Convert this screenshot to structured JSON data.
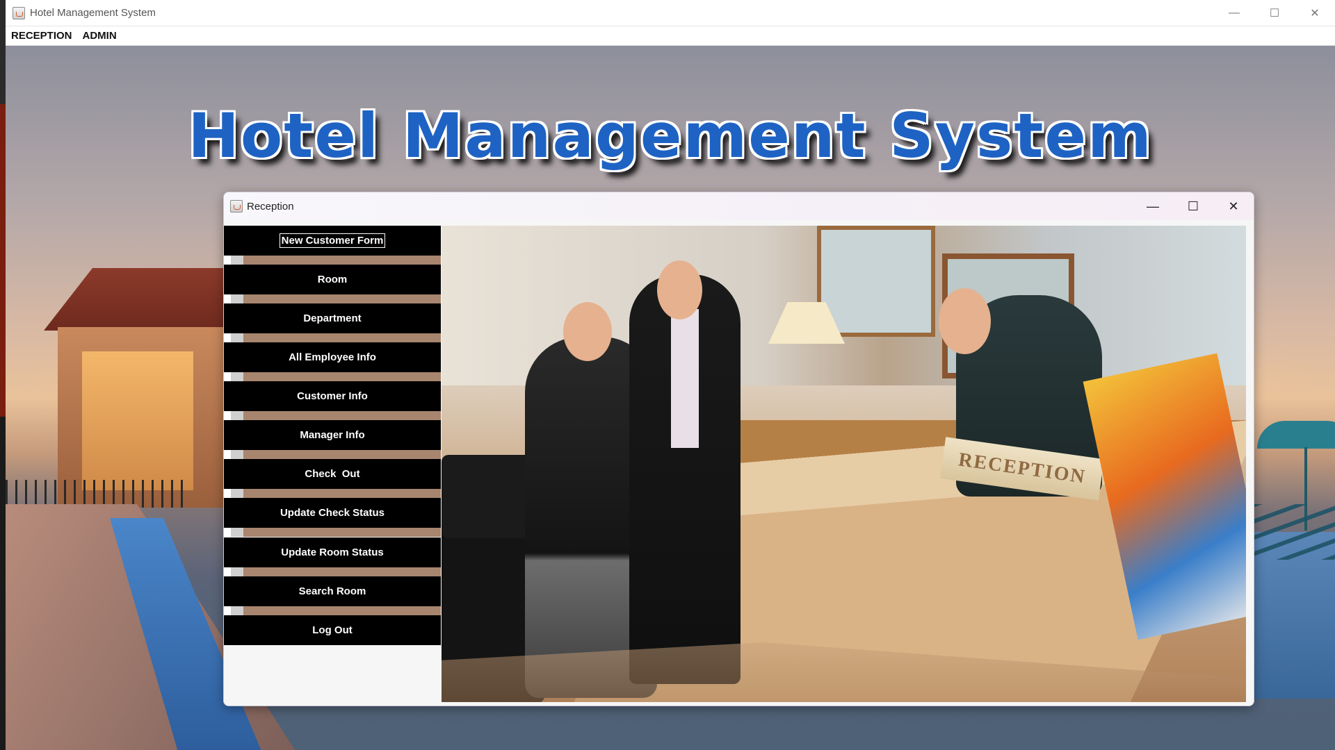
{
  "app": {
    "window_title": "Hotel Management System",
    "title_icon": "java-cup-icon",
    "controls": {
      "minimize": "—",
      "maximize": "☐",
      "close": "✕"
    }
  },
  "menubar": {
    "items": [
      "RECEPTION",
      "ADMIN"
    ]
  },
  "hero": {
    "title": "Hotel Management System",
    "title_color": "#1e63c4"
  },
  "reception": {
    "title": "Reception",
    "icon": "java-cup-icon",
    "controls": {
      "minimize": "—",
      "maximize": "☐",
      "close": "✕"
    },
    "buttons": [
      {
        "label": "New Customer Form",
        "focused": true
      },
      {
        "label": "Room"
      },
      {
        "label": "Department"
      },
      {
        "label": "All Employee Info"
      },
      {
        "label": "Customer Info"
      },
      {
        "label": "Manager Info"
      },
      {
        "label": "Check  Out"
      },
      {
        "label": "Update Check Status"
      },
      {
        "label": "Update Room Status"
      },
      {
        "label": "Search Room"
      },
      {
        "label": "Log Out"
      }
    ],
    "photo_sign": "RECEPTION"
  },
  "colors": {
    "button_bg": "#000000",
    "button_text": "#ffffff"
  }
}
